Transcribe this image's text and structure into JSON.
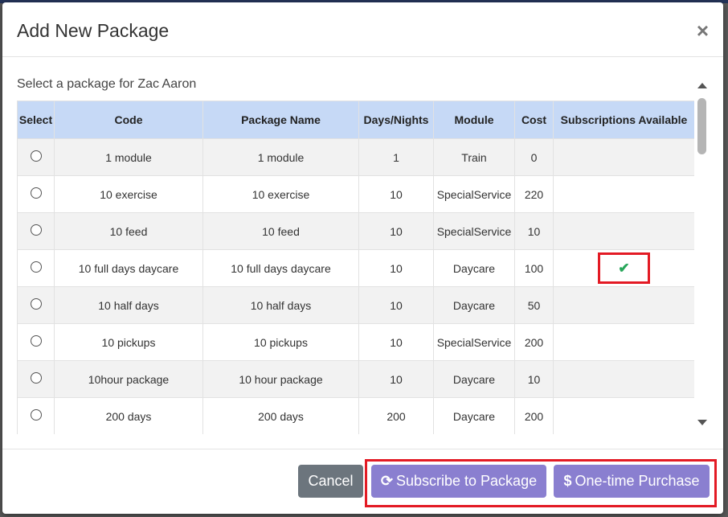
{
  "modal": {
    "title": "Add New Package",
    "close_label": "×"
  },
  "body": {
    "subtitle": "Select a package for Zac Aaron"
  },
  "table": {
    "headers": [
      "Select",
      "Code",
      "Package Name",
      "Days/Nights",
      "Module",
      "Cost",
      "Subscriptions Available"
    ],
    "rows": [
      {
        "code": "1 module",
        "name": "1 module",
        "days": "1",
        "module": "Train",
        "cost": "0",
        "subscription": ""
      },
      {
        "code": "10 exercise",
        "name": "10 exercise",
        "days": "10",
        "module": "SpecialService",
        "cost": "220",
        "subscription": ""
      },
      {
        "code": "10 feed",
        "name": "10 feed",
        "days": "10",
        "module": "SpecialService",
        "cost": "10",
        "subscription": ""
      },
      {
        "code": "10 full days daycare",
        "name": "10 full days daycare",
        "days": "10",
        "module": "Daycare",
        "cost": "100",
        "subscription": "✔"
      },
      {
        "code": "10 half days",
        "name": "10 half days",
        "days": "10",
        "module": "Daycare",
        "cost": "50",
        "subscription": ""
      },
      {
        "code": "10 pickups",
        "name": "10 pickups",
        "days": "10",
        "module": "SpecialService",
        "cost": "200",
        "subscription": ""
      },
      {
        "code": "10hour package",
        "name": "10 hour package",
        "days": "10",
        "module": "Daycare",
        "cost": "10",
        "subscription": ""
      },
      {
        "code": "200 days",
        "name": "200 days",
        "days": "200",
        "module": "Daycare",
        "cost": "200",
        "subscription": ""
      }
    ]
  },
  "footer": {
    "cancel_label": "Cancel",
    "subscribe_label": "Subscribe to Package",
    "subscribe_icon": "refresh-icon",
    "purchase_label": "One-time Purchase",
    "purchase_icon": "dollar-icon"
  },
  "colors": {
    "header_bg": "#c6d9f6",
    "button_primary": "#8a7fd0",
    "button_cancel": "#6c757d",
    "highlight": "#e31a24",
    "check": "#27a65a"
  }
}
